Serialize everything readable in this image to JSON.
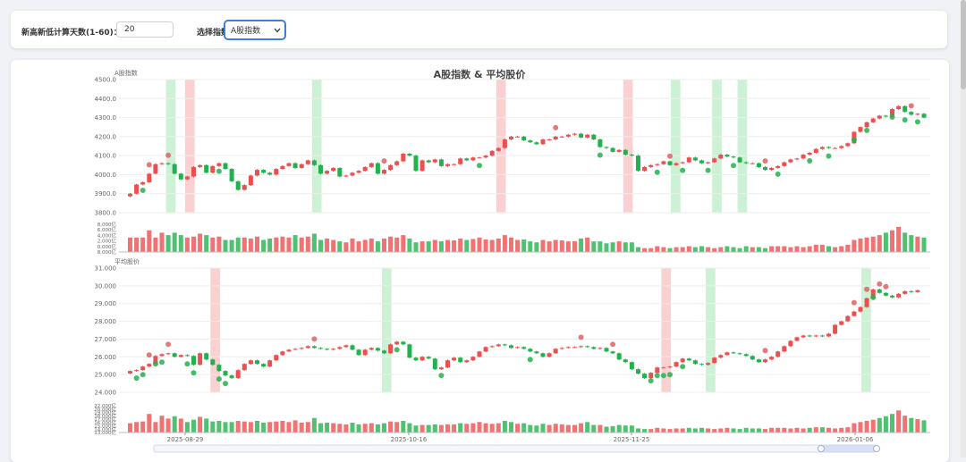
{
  "controls": {
    "days_label": "新高新低计算天数(1-60)：",
    "days_value": "20",
    "index_label": "选择指数：",
    "index_value": "A股指数"
  },
  "chart": {
    "title": "A股指数 & 平均股价",
    "colors": {
      "up": "#ec4f4f",
      "down": "#23b14d",
      "high_band": "#ccf1d4",
      "low_band": "#fad0d0",
      "marker": "#e06262"
    }
  },
  "chart_data": [
    {
      "type": "candlestick",
      "title": "A股指数 & 平均股价",
      "ylabel": "A股指数",
      "ylim": [
        3800,
        4500
      ],
      "yticks": [
        "4500.0",
        "4400.0",
        "4300.0",
        "4200.0",
        "4100.0",
        "4000.0",
        "3900.0",
        "3800.0"
      ],
      "close": [
        3900,
        3948,
        3960,
        4005,
        4055,
        4060,
        4055,
        4005,
        3975,
        3990,
        4040,
        4050,
        4010,
        4045,
        4060,
        4030,
        3965,
        3920,
        3945,
        3995,
        4025,
        4010,
        4000,
        4030,
        4045,
        4060,
        4035,
        4055,
        4075,
        4050,
        4005,
        4020,
        4035,
        3990,
        3995,
        4010,
        4020,
        4040,
        4060,
        4005,
        4025,
        4050,
        4070,
        4110,
        4100,
        4020,
        4075,
        4065,
        4080,
        4045,
        4055,
        4055,
        4085,
        4075,
        4090,
        4090,
        4100,
        4125,
        4140,
        4185,
        4200,
        4200,
        4180,
        4170,
        4160,
        4185,
        4185,
        4200,
        4200,
        4210,
        4215,
        4195,
        4210,
        4185,
        4145,
        4140,
        4120,
        4130,
        4105,
        4100,
        4020,
        4040,
        4050,
        4055,
        4070,
        4050,
        4060,
        4065,
        4090,
        4075,
        4060,
        4065,
        4085,
        4105,
        4095,
        4090,
        4065,
        4060,
        4060,
        4040,
        4025,
        4035,
        4045,
        4065,
        4080,
        4085,
        4105,
        4115,
        4135,
        4145,
        4140,
        4140,
        4150,
        4165,
        4225,
        4250,
        4275,
        4295,
        4310,
        4305,
        4345,
        4360,
        4330,
        4315,
        4320,
        4300
      ],
      "volume": [
        30,
        30,
        30,
        45,
        30,
        40,
        35,
        40,
        35,
        30,
        32,
        38,
        35,
        30,
        32,
        25,
        25,
        30,
        30,
        28,
        32,
        25,
        28,
        30,
        32,
        30,
        35,
        30,
        32,
        38,
        25,
        28,
        25,
        22,
        20,
        28,
        22,
        25,
        28,
        22,
        28,
        32,
        30,
        35,
        28,
        20,
        22,
        22,
        25,
        22,
        25,
        24,
        28,
        25,
        27,
        30,
        26,
        25,
        28,
        35,
        30,
        25,
        26,
        22,
        20,
        25,
        22,
        25,
        24,
        22,
        22,
        28,
        30,
        22,
        22,
        18,
        20,
        22,
        20,
        20,
        10,
        8,
        8,
        12,
        10,
        8,
        10,
        10,
        12,
        10,
        12,
        10,
        8,
        10,
        12,
        10,
        8,
        12,
        10,
        10,
        8,
        12,
        12,
        12,
        10,
        12,
        10,
        12,
        15,
        15,
        12,
        10,
        12,
        15,
        25,
        28,
        30,
        32,
        35,
        40,
        45,
        52,
        40,
        35,
        32,
        30
      ],
      "new_highs": [
        3,
        6,
        40,
        67,
        85,
        100,
        123
      ],
      "new_lows": [
        2,
        14,
        55,
        74,
        83,
        87,
        91,
        95,
        102,
        107,
        110,
        114,
        116,
        120,
        122,
        124
      ],
      "high_bands": [
        [
          6,
          7.5
        ],
        [
          29,
          30.5
        ],
        [
          85.5,
          87
        ],
        [
          92,
          93.5
        ],
        [
          96,
          97.5
        ]
      ],
      "low_bands": [
        [
          9,
          10.5
        ],
        [
          58,
          59.5
        ],
        [
          78,
          79.5
        ]
      ]
    },
    {
      "type": "candlestick",
      "ylabel": "平均股价",
      "ylim": [
        24,
        31
      ],
      "yticks": [
        "31.000",
        "30.000",
        "29.000",
        "28.000",
        "27.000",
        "26.000",
        "25.000",
        "24.000"
      ],
      "close": [
        25.2,
        25.25,
        25.45,
        25.6,
        26.05,
        26.15,
        26.2,
        26.0,
        26.1,
        26.05,
        25.55,
        26.2,
        25.85,
        25.55,
        25.2,
        24.95,
        24.8,
        25.25,
        25.6,
        25.8,
        25.6,
        25.45,
        25.8,
        26.1,
        26.3,
        26.4,
        26.45,
        26.5,
        26.6,
        26.5,
        26.45,
        26.4,
        26.45,
        26.55,
        26.65,
        26.4,
        26.1,
        26.4,
        26.5,
        26.35,
        26.2,
        26.7,
        26.85,
        26.7,
        25.95,
        25.8,
        26.0,
        25.9,
        25.3,
        25.4,
        25.8,
        25.95,
        25.7,
        25.8,
        26.0,
        26.3,
        26.55,
        26.6,
        26.7,
        26.65,
        26.5,
        26.55,
        26.45,
        26.3,
        26.2,
        26.0,
        26.2,
        26.45,
        26.5,
        26.55,
        26.55,
        26.6,
        26.55,
        26.45,
        26.5,
        26.3,
        26.2,
        25.85,
        25.7,
        25.3,
        25.05,
        24.8,
        25.1,
        25.4,
        25.4,
        25.45,
        25.7,
        25.9,
        25.8,
        25.6,
        25.55,
        25.65,
        25.95,
        26.1,
        26.25,
        26.2,
        26.15,
        26.05,
        25.85,
        25.7,
        25.85,
        26.0,
        26.3,
        26.6,
        26.9,
        27.1,
        27.2,
        27.15,
        27.2,
        27.15,
        27.3,
        27.8,
        28.0,
        28.3,
        28.55,
        28.8,
        29.3,
        29.8,
        29.6,
        29.45,
        29.35,
        29.55,
        29.7,
        29.65,
        29.75
      ],
      "volume": [
        14.6,
        14.8,
        14.9,
        16.2,
        14.8,
        15.9,
        15.4,
        15.8,
        15.4,
        14.8,
        15.2,
        15.7,
        15.4,
        14.9,
        15.0,
        14.8,
        14.8,
        15.0,
        14.9,
        14.8,
        15.0,
        14.7,
        14.8,
        14.9,
        15.0,
        14.8,
        15.1,
        14.7,
        14.8,
        15.5,
        14.6,
        14.7,
        14.6,
        14.5,
        14.4,
        14.7,
        14.4,
        14.5,
        14.6,
        14.4,
        14.6,
        14.9,
        14.8,
        15.0,
        14.6,
        14.2,
        14.3,
        14.3,
        14.4,
        14.3,
        14.4,
        14.4,
        14.6,
        14.5,
        14.6,
        14.8,
        14.6,
        14.5,
        14.6,
        15.0,
        14.8,
        14.5,
        14.6,
        14.3,
        14.2,
        14.5,
        14.3,
        14.5,
        14.4,
        14.3,
        14.3,
        14.6,
        14.8,
        14.3,
        14.3,
        14.0,
        14.1,
        14.3,
        14.2,
        14.2,
        13.7,
        13.6,
        13.6,
        13.8,
        13.7,
        13.6,
        13.7,
        13.7,
        13.8,
        13.7,
        13.8,
        13.7,
        13.6,
        13.7,
        13.8,
        13.7,
        13.6,
        13.8,
        13.7,
        13.7,
        13.6,
        13.8,
        13.8,
        13.8,
        13.7,
        13.8,
        13.7,
        13.8,
        13.9,
        13.9,
        13.8,
        13.7,
        13.8,
        13.9,
        14.6,
        14.8,
        15.0,
        15.2,
        15.5,
        15.8,
        16.2,
        16.8,
        15.9,
        15.5,
        15.3,
        15.1
      ],
      "new_highs": [
        3,
        6,
        29,
        71,
        76,
        100,
        114,
        116,
        118,
        119
      ],
      "new_lows": [
        1,
        2,
        4,
        5,
        9,
        10,
        14,
        15,
        42,
        49,
        63,
        82,
        83,
        84,
        85,
        87,
        117
      ],
      "high_bands": [
        [
          40,
          41.5
        ],
        [
          91,
          92.5
        ],
        [
          115.5,
          117
        ]
      ],
      "low_bands": [
        [
          13,
          14.5
        ],
        [
          84,
          85.5
        ]
      ]
    }
  ],
  "x_axis": {
    "labels": [
      "2025-08-29",
      "2025-10-16",
      "2025-11-25",
      "2026-01-06"
    ]
  },
  "vol_axes": [
    {
      "yticks": [
        "8,000亿",
        "6,000亿",
        "4,000亿",
        "2,000亿",
        "0,000亿",
        "8,000亿"
      ]
    },
    {
      "yticks": [
        "22,000亿",
        "20,000亿",
        "19,000亿",
        "18,000亿",
        "17,000亿",
        "16,000亿",
        "15,000亿",
        "14,000亿",
        "13,000亿"
      ]
    }
  ]
}
